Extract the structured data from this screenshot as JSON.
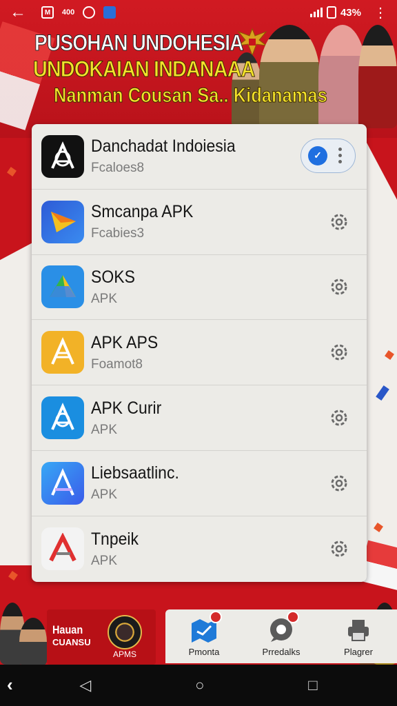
{
  "status_bar": {
    "back_icon": "arrow-left-icon",
    "app_icons": [
      "gmail-icon",
      "400",
      "instagram-icon",
      "bag-icon"
    ],
    "right_text": "43%",
    "battery_prefix": "",
    "more_icon": "more-vert-icon"
  },
  "banner": {
    "line1": "PUSOHAN UNDOHESIA",
    "line2": "UNDOKAIAN INDANAAA",
    "line3": "Nanman Cousan Sa.. Kidanamas"
  },
  "apps": [
    {
      "name": "Danchadat Indoiesia",
      "sub": "Fcaloes8",
      "icon": "app-logo-black",
      "color": "#111111",
      "action": "toggle"
    },
    {
      "name": "Smcanpa APK",
      "sub": "Fcabies3",
      "icon": "play-triangle",
      "color": "#2e5bd6",
      "action": "settings"
    },
    {
      "name": "SOKS",
      "sub": "APK",
      "icon": "drive-triangle",
      "color": "#2a8fe6",
      "action": "settings"
    },
    {
      "name": "APK APS",
      "sub": "Foamot8",
      "icon": "app-logo-yellow",
      "color": "#f2b227",
      "action": "settings"
    },
    {
      "name": "APK Curir",
      "sub": "APK",
      "icon": "app-logo-blue",
      "color": "#1a8ee0",
      "action": "settings"
    },
    {
      "name": "Liebsaatlinc.",
      "sub": "APK",
      "icon": "app-logo-gradient",
      "color": "#2b8af0",
      "action": "settings"
    },
    {
      "name": "Tnpeik",
      "sub": "APK",
      "icon": "app-logo-red",
      "color": "#f3f3f3",
      "action": "settings"
    }
  ],
  "promo": {
    "line1": "Hauan",
    "line2": "CUANSU",
    "badge": "APMS"
  },
  "bottom_tabs": [
    {
      "label": "Pmonta",
      "icon": "map-icon"
    },
    {
      "label": "Prredalks",
      "icon": "chat-icon"
    },
    {
      "label": "Plagrer",
      "icon": "printer-icon"
    }
  ],
  "nav": {
    "back": "‹",
    "triangle": "◁",
    "circle": "○",
    "square": "□"
  }
}
